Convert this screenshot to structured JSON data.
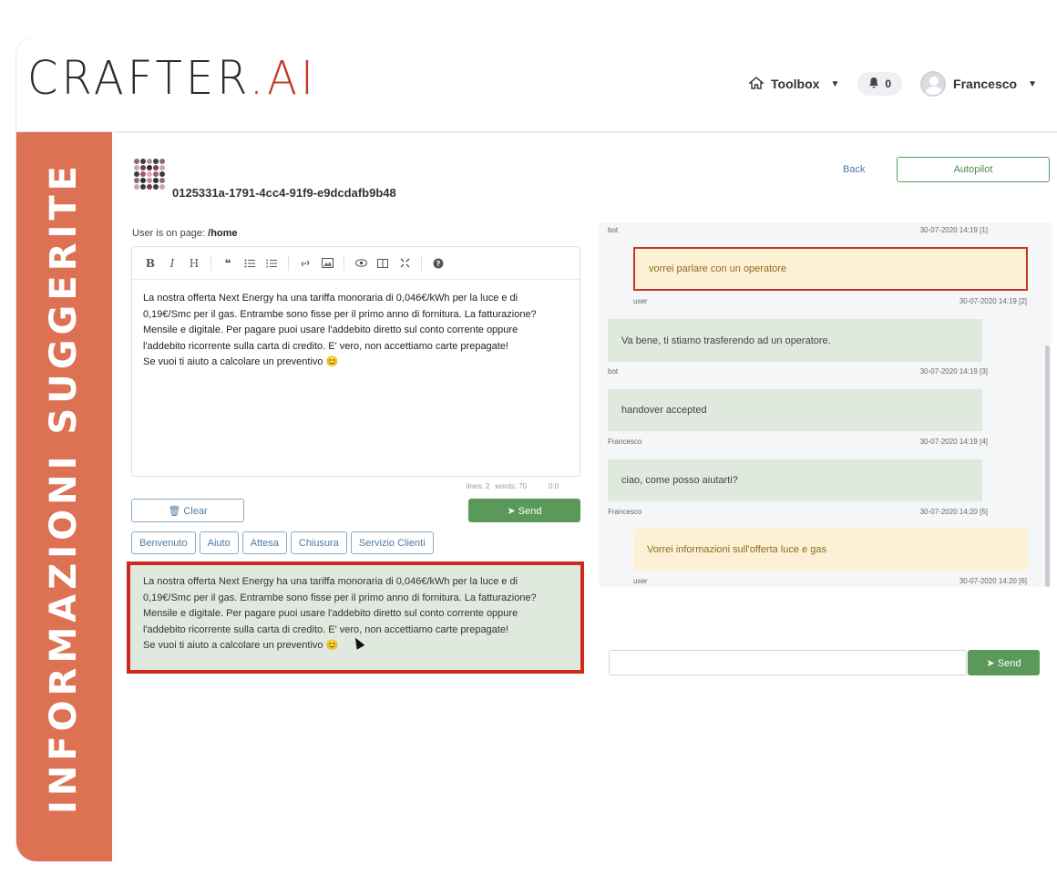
{
  "header": {
    "logo_text": "CRAFTER",
    "logo_dot": ".AI",
    "nav": {
      "toolbox_label": "Toolbox",
      "notifications_count": "0",
      "user_name": "Francesco"
    }
  },
  "sidebar": {
    "vertical_label": "INFORMAZIONI SUGGERITE"
  },
  "conversation": {
    "id": "0125331a-1791-4cc4-91f9-e9dcdafb9b48",
    "back_label": "Back",
    "autopilot_label": "Autopilot"
  },
  "editor": {
    "page_label": "User is on page: ",
    "page_path": "/home",
    "toolbar_icons": [
      "bold-icon",
      "italic-icon",
      "heading-icon",
      "quote-icon",
      "unordered-list-icon",
      "ordered-list-icon",
      "link-icon",
      "image-icon",
      "preview-icon",
      "side-by-side-icon",
      "fullscreen-icon",
      "help-icon"
    ],
    "text_line1": "La nostra offerta Next Energy ha una tariffa monoraria di 0,046€/kWh per la luce e di",
    "text_line2": "0,19€/Smc per il gas. Entrambe sono fisse per il primo anno di fornitura. La fatturazione?",
    "text_line3": "Mensile e digitale. Per pagare puoi usare l'addebito diretto sul conto corrente oppure",
    "text_line4": "l'addebito ricorrente sulla carta di credito. E' vero, non accettiamo carte prepagate!",
    "text_line5": "Se vuoi ti aiuto a calcolare un preventivo 😊",
    "status_lines": "lines: 2",
    "status_words": "words: 70",
    "status_cursor": "0:0",
    "clear_label": "Clear",
    "send_label": "Send"
  },
  "quick_replies": [
    "Benvenuto",
    "Aiuto",
    "Attesa",
    "Chiusura",
    "Servizio Clienti"
  ],
  "suggestion": {
    "line1": "La nostra offerta Next Energy ha una tariffa monoraria di 0,046€/kWh per la luce e di",
    "line2": "0,19€/Smc per il gas. Entrambe sono fisse per il primo anno di fornitura. La fatturazione?",
    "line3": "Mensile e digitale. Per pagare puoi usare l'addebito diretto sul conto corrente oppure",
    "line4": "l'addebito ricorrente sulla carta di credito. E' vero, non accettiamo carte prepagate!",
    "line5": "Se vuoi ti aiuto a calcolare un preventivo 😊"
  },
  "chat": {
    "top_sender": "bot",
    "top_time": "30-07-2020 14:19 [1]",
    "messages": [
      {
        "text": "vorrei parlare con un operatore",
        "sender": "user",
        "time": "30-07-2020 14:19 [2]"
      },
      {
        "text": "Va bene, ti stiamo trasferendo ad un operatore.",
        "sender": "bot",
        "time": "30-07-2020 14:19 [3]"
      },
      {
        "text": "handover accepted",
        "sender": "Francesco",
        "time": "30-07-2020 14:19 [4]"
      },
      {
        "text": "ciao, come posso aiutarti?",
        "sender": "Francesco",
        "time": "30-07-2020 14:20 [5]"
      },
      {
        "text": "Vorrei informazioni sull'offerta luce e gas",
        "sender": "user",
        "time": "30-07-2020 14:20 [6]"
      }
    ],
    "reply_send_label": "Send"
  }
}
